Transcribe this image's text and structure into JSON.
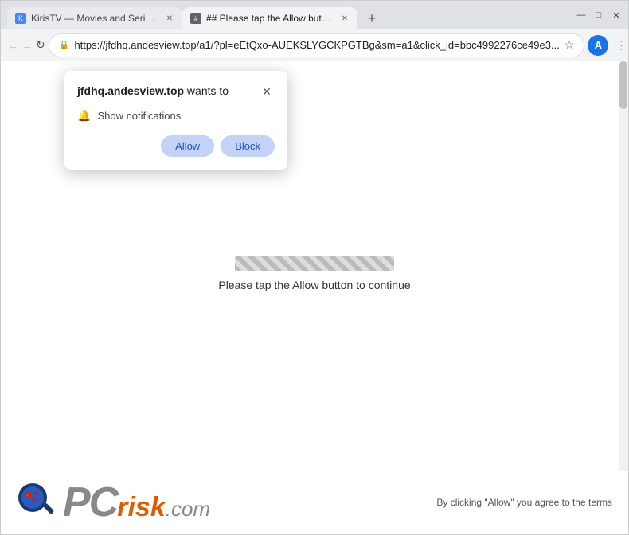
{
  "browser": {
    "tabs": [
      {
        "id": "tab1",
        "title": "KirisTV — Movies and Series D...",
        "favicon_text": "K",
        "active": false
      },
      {
        "id": "tab2",
        "title": "## Please tap the Allow button...",
        "favicon_text": "#",
        "active": true
      }
    ],
    "new_tab_label": "+",
    "window_controls": {
      "minimize": "—",
      "maximize": "□",
      "close": "✕"
    }
  },
  "nav": {
    "back_btn": "←",
    "forward_btn": "→",
    "refresh_btn": "↻",
    "address_lock_icon": "🔒",
    "address_url": "https://jfdhq.andesview.top/a1/?pl=eEtQxo-AUEKSLYGCKPGTBg&sm=a1&click_id=bbc4992276ce49e3...",
    "star_icon": "☆",
    "profile_initial": "A",
    "more_icon": "⋮"
  },
  "dialog": {
    "title_domain": "jfdhq.andesview.top",
    "title_suffix": " wants to",
    "close_icon": "✕",
    "option_icon": "🔔",
    "option_text": "Show notifications",
    "allow_button": "Allow",
    "block_button": "Block"
  },
  "page": {
    "instruction_text": "Please tap the Allow button to continue"
  },
  "footer": {
    "logo_pc": "PC",
    "logo_risk": "risk",
    "logo_com": ".com",
    "terms_text": "By clicking \"Allow\" you agree to the terms"
  }
}
